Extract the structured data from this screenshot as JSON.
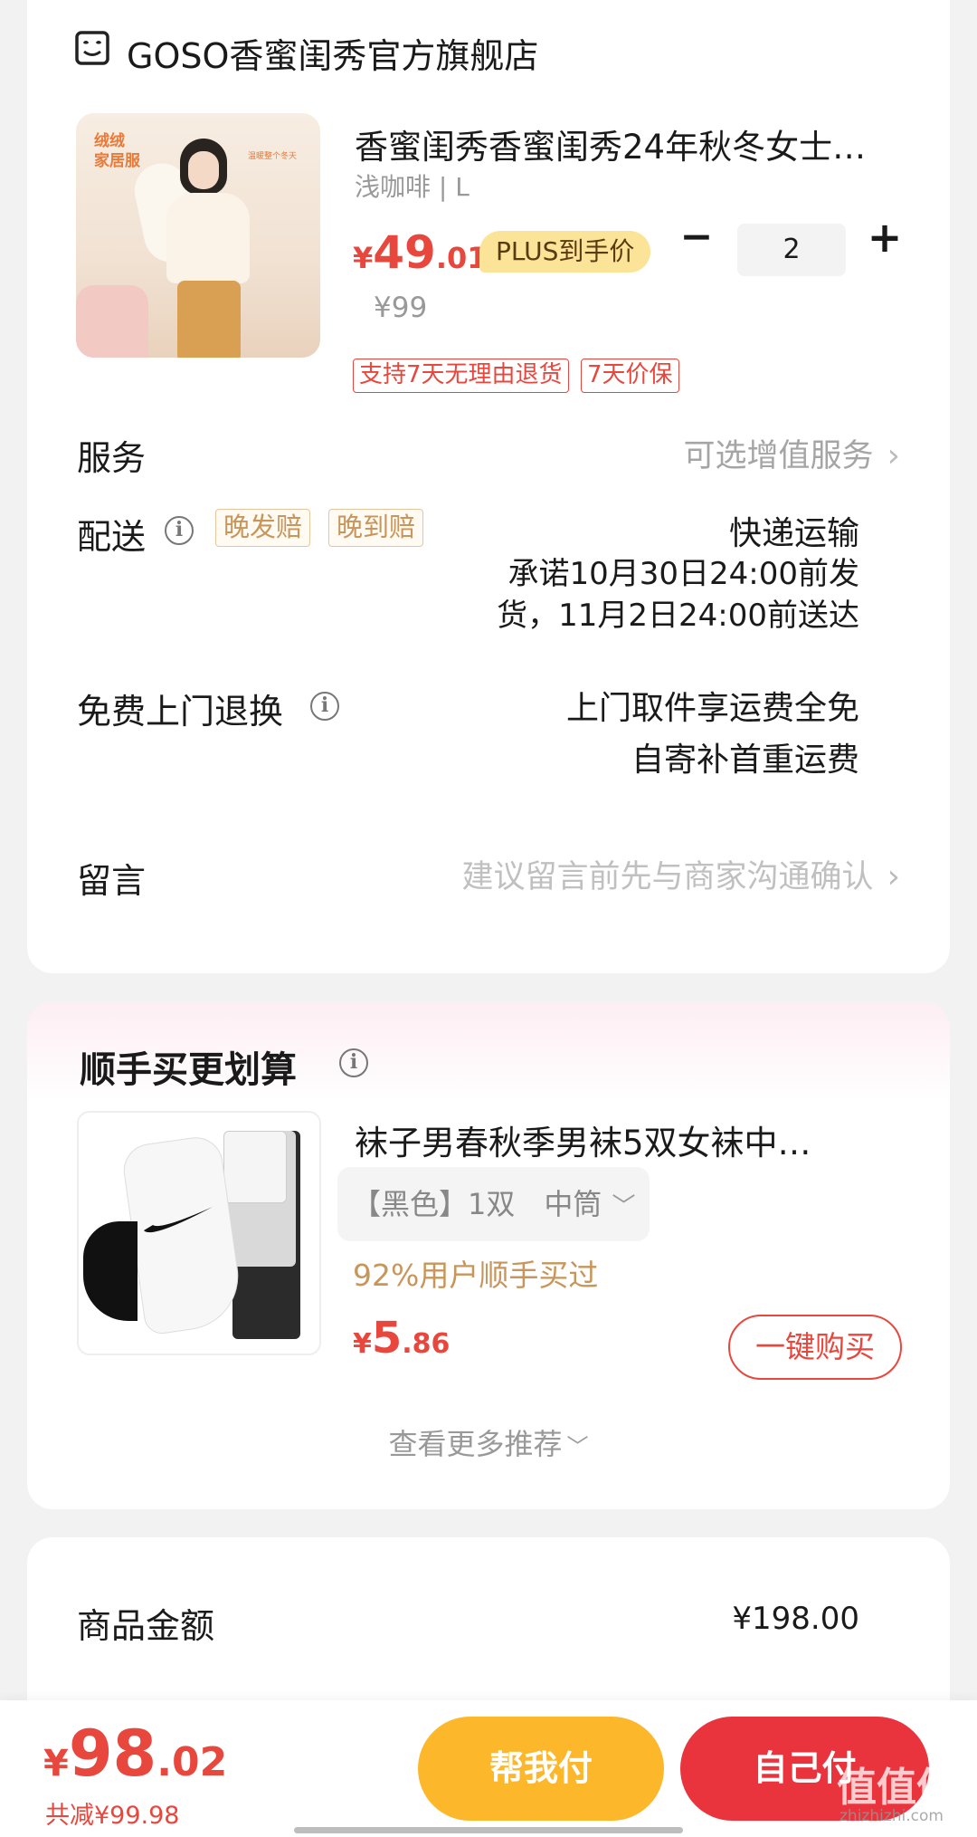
{
  "store": {
    "icon": "store-face-icon",
    "name": "GOSO香蜜闺秀官方旗舰店"
  },
  "product": {
    "image_text_1": "绒绒\n家居服",
    "image_text_2": "温暖整个冬天",
    "title": "香蜜闺秀香蜜闺秀24年秋冬女士…",
    "spec": "浅咖啡 | L",
    "price_symbol": "¥",
    "price_int": "49",
    "price_dec": ".01",
    "plus_badge": "PLUS到手价",
    "original_price": "¥99",
    "quantity": "2",
    "minus": "−",
    "plus": "+",
    "tags": [
      "支持7天无理由退货",
      "7天价保"
    ]
  },
  "service": {
    "label": "服务",
    "value": "可选增值服务"
  },
  "delivery": {
    "label": "配送",
    "badges": [
      "晚发赔",
      "晚到赔"
    ],
    "method": "快递运输",
    "promise_line1": "承诺10月30日24:00前发",
    "promise_line2": "货，11月2日24:00前送达"
  },
  "return_service": {
    "label": "免费上门退换",
    "line1": "上门取件享运费全免",
    "line2": "自寄补首重运费"
  },
  "message": {
    "label": "留言",
    "placeholder": "建议留言前先与商家沟通确认"
  },
  "recommend": {
    "title": "顺手买更划算",
    "item": {
      "title": "袜子男春秋季男袜5双女袜中…",
      "spec": "【黑色】1双　中筒",
      "social": "92%用户顺手买过",
      "price_symbol": "¥",
      "price_int": "5",
      "price_dec": ".86",
      "buy_label": "一键购买"
    },
    "more": "查看更多推荐"
  },
  "summary": {
    "label": "商品金额",
    "value": "¥198.00"
  },
  "bottom_bar": {
    "price_symbol": "¥",
    "price_int": "98",
    "price_dec": ".02",
    "saved": "共减¥99.98",
    "help_pay": "帮我付",
    "self_pay": "自己付",
    "watermark": "值值值",
    "watermark_url": "zhizhizhi.com"
  },
  "colors": {
    "accent_red": "#e8473d",
    "gold": "#c8955a",
    "help_btn": "#fdb72a",
    "self_btn": "#e9343d"
  }
}
